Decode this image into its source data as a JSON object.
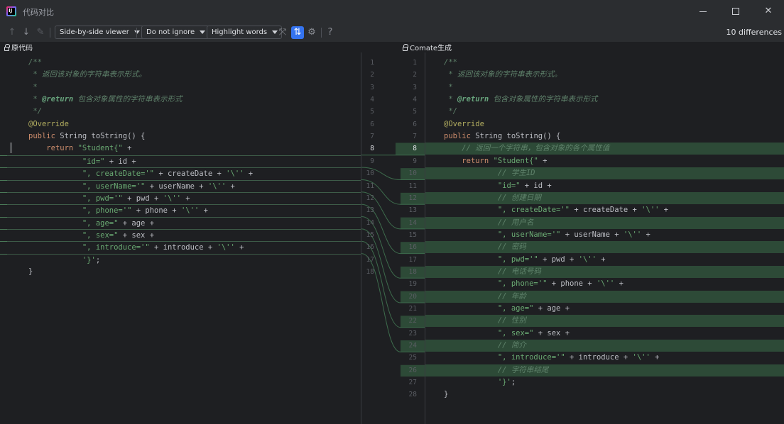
{
  "window": {
    "title": "代码对比",
    "app_icon_text": "IJ",
    "minimize_icon": "minimize-icon",
    "maximize_icon": "maximize-icon",
    "close_icon": "close-icon"
  },
  "toolbar": {
    "prev_icon": "arrow-up-icon",
    "next_icon": "arrow-down-icon",
    "edit_icon": "pencil-icon",
    "viewer_mode": "Side-by-side viewer",
    "ignore_mode": "Do not ignore",
    "highlight_mode": "Highlight words",
    "collapse_icon": "collapse-unchanged-icon",
    "sync_scroll_icon": "sync-scroll-icon",
    "settings_icon": "gear-icon",
    "help_label": "?",
    "differences": "10 differences"
  },
  "left_panel": {
    "title": "原代码",
    "lines": [
      [
        [
          "c-comment",
          "/**"
        ]
      ],
      [
        [
          "c-comment",
          " * 返回该对象的字符串表示形式。"
        ]
      ],
      [
        [
          "c-comment",
          " *"
        ]
      ],
      [
        [
          "c-comment",
          " * "
        ],
        [
          "c-doctag",
          "@return"
        ],
        [
          "c-comment",
          " 包含对象属性的字符串表示形式"
        ]
      ],
      [
        [
          "c-comment",
          " */"
        ]
      ],
      [
        [
          "c-ann",
          "@Override"
        ]
      ],
      [
        [
          "c-kw",
          "public "
        ],
        [
          "c-plain",
          "String toString() {"
        ]
      ],
      [
        [
          "c-plain",
          "    "
        ],
        [
          "c-kw",
          "return "
        ],
        [
          "c-str",
          "\"Student{\""
        ],
        [
          "c-plain",
          " +"
        ]
      ],
      [
        [
          "c-plain",
          "            "
        ],
        [
          "c-str",
          "\"id=\""
        ],
        [
          "c-plain",
          " + id +"
        ]
      ],
      [
        [
          "c-plain",
          "            "
        ],
        [
          "c-str",
          "\", createDate='\""
        ],
        [
          "c-plain",
          " + createDate + "
        ],
        [
          "c-str",
          "'\\''"
        ],
        [
          "c-plain",
          " +"
        ]
      ],
      [
        [
          "c-plain",
          "            "
        ],
        [
          "c-str",
          "\", userName='\""
        ],
        [
          "c-plain",
          " + userName + "
        ],
        [
          "c-str",
          "'\\''"
        ],
        [
          "c-plain",
          " +"
        ]
      ],
      [
        [
          "c-plain",
          "            "
        ],
        [
          "c-str",
          "\", pwd='\""
        ],
        [
          "c-plain",
          " + pwd + "
        ],
        [
          "c-str",
          "'\\''"
        ],
        [
          "c-plain",
          " +"
        ]
      ],
      [
        [
          "c-plain",
          "            "
        ],
        [
          "c-str",
          "\", phone='\""
        ],
        [
          "c-plain",
          " + phone + "
        ],
        [
          "c-str",
          "'\\''"
        ],
        [
          "c-plain",
          " +"
        ]
      ],
      [
        [
          "c-plain",
          "            "
        ],
        [
          "c-str",
          "\", age=\""
        ],
        [
          "c-plain",
          " + age +"
        ]
      ],
      [
        [
          "c-plain",
          "            "
        ],
        [
          "c-str",
          "\", sex=\""
        ],
        [
          "c-plain",
          " + sex +"
        ]
      ],
      [
        [
          "c-plain",
          "            "
        ],
        [
          "c-str",
          "\", introduce='\""
        ],
        [
          "c-plain",
          " + introduce + "
        ],
        [
          "c-str",
          "'\\''"
        ],
        [
          "c-plain",
          " +"
        ]
      ],
      [
        [
          "c-plain",
          "            "
        ],
        [
          "c-str",
          "'}'"
        ],
        [
          "c-plain",
          ";"
        ]
      ],
      [
        [
          "c-plain",
          "}"
        ]
      ]
    ],
    "line_numbers": [
      "1",
      "2",
      "3",
      "4",
      "5",
      "6",
      "7",
      "8",
      "9",
      "10",
      "11",
      "12",
      "13",
      "14",
      "15",
      "16",
      "17",
      "18"
    ]
  },
  "right_panel": {
    "title": "Comate生成",
    "lines": [
      [
        [
          "c-comment",
          "/**"
        ]
      ],
      [
        [
          "c-comment",
          " * 返回该对象的字符串表示形式。"
        ]
      ],
      [
        [
          "c-comment",
          " *"
        ]
      ],
      [
        [
          "c-comment",
          " * "
        ],
        [
          "c-doctag",
          "@return"
        ],
        [
          "c-comment",
          " 包含对象属性的字符串表示形式"
        ]
      ],
      [
        [
          "c-comment",
          " */"
        ]
      ],
      [
        [
          "c-ann",
          "@Override"
        ]
      ],
      [
        [
          "c-kw",
          "public "
        ],
        [
          "c-plain",
          "String toString() {"
        ]
      ],
      [
        [
          "c-plain",
          "    "
        ],
        [
          "c-comment",
          "// 返回一个字符串，包含对象的各个属性值"
        ]
      ],
      [
        [
          "c-plain",
          "    "
        ],
        [
          "c-kw",
          "return "
        ],
        [
          "c-str",
          "\"Student{\""
        ],
        [
          "c-plain",
          " +"
        ]
      ],
      [
        [
          "c-plain",
          "            "
        ],
        [
          "c-comment",
          "// 学生ID"
        ]
      ],
      [
        [
          "c-plain",
          "            "
        ],
        [
          "c-str",
          "\"id=\""
        ],
        [
          "c-plain",
          " + id +"
        ]
      ],
      [
        [
          "c-plain",
          "            "
        ],
        [
          "c-comment",
          "// 创建日期"
        ]
      ],
      [
        [
          "c-plain",
          "            "
        ],
        [
          "c-str",
          "\", createDate='\""
        ],
        [
          "c-plain",
          " + createDate + "
        ],
        [
          "c-str",
          "'\\''"
        ],
        [
          "c-plain",
          " +"
        ]
      ],
      [
        [
          "c-plain",
          "            "
        ],
        [
          "c-comment",
          "// 用户名"
        ]
      ],
      [
        [
          "c-plain",
          "            "
        ],
        [
          "c-str",
          "\", userName='\""
        ],
        [
          "c-plain",
          " + userName + "
        ],
        [
          "c-str",
          "'\\''"
        ],
        [
          "c-plain",
          " +"
        ]
      ],
      [
        [
          "c-plain",
          "            "
        ],
        [
          "c-comment",
          "// 密码"
        ]
      ],
      [
        [
          "c-plain",
          "            "
        ],
        [
          "c-str",
          "\", pwd='\""
        ],
        [
          "c-plain",
          " + pwd + "
        ],
        [
          "c-str",
          "'\\''"
        ],
        [
          "c-plain",
          " +"
        ]
      ],
      [
        [
          "c-plain",
          "            "
        ],
        [
          "c-comment",
          "// 电话号码"
        ]
      ],
      [
        [
          "c-plain",
          "            "
        ],
        [
          "c-str",
          "\", phone='\""
        ],
        [
          "c-plain",
          " + phone + "
        ],
        [
          "c-str",
          "'\\''"
        ],
        [
          "c-plain",
          " +"
        ]
      ],
      [
        [
          "c-plain",
          "            "
        ],
        [
          "c-comment",
          "// 年龄"
        ]
      ],
      [
        [
          "c-plain",
          "            "
        ],
        [
          "c-str",
          "\", age=\""
        ],
        [
          "c-plain",
          " + age +"
        ]
      ],
      [
        [
          "c-plain",
          "            "
        ],
        [
          "c-comment",
          "// 性别"
        ]
      ],
      [
        [
          "c-plain",
          "            "
        ],
        [
          "c-str",
          "\", sex=\""
        ],
        [
          "c-plain",
          " + sex +"
        ]
      ],
      [
        [
          "c-plain",
          "            "
        ],
        [
          "c-comment",
          "// 简介"
        ]
      ],
      [
        [
          "c-plain",
          "            "
        ],
        [
          "c-str",
          "\", introduce='\""
        ],
        [
          "c-plain",
          " + introduce + "
        ],
        [
          "c-str",
          "'\\''"
        ],
        [
          "c-plain",
          " +"
        ]
      ],
      [
        [
          "c-plain",
          "            "
        ],
        [
          "c-comment",
          "// 字符串结尾"
        ]
      ],
      [
        [
          "c-plain",
          "            "
        ],
        [
          "c-str",
          "'}'"
        ],
        [
          "c-plain",
          ";"
        ]
      ],
      [
        [
          "c-plain",
          "}"
        ]
      ]
    ],
    "line_numbers": [
      "1",
      "2",
      "3",
      "4",
      "5",
      "6",
      "7",
      "8",
      "9",
      "10",
      "11",
      "12",
      "13",
      "14",
      "15",
      "16",
      "17",
      "18",
      "19",
      "20",
      "21",
      "22",
      "23",
      "24",
      "25",
      "26",
      "27",
      "28"
    ],
    "changed_lines": [
      8,
      9,
      10,
      11,
      12,
      13,
      14,
      15,
      16,
      17,
      18,
      19,
      20,
      21,
      22,
      23,
      24,
      25,
      26
    ],
    "current_line": 8
  },
  "colors": {
    "changed_bg": "#2d4a37",
    "connector": "#3d6b4c",
    "editor_bg": "#1e1f22",
    "toolbar_bg": "#2b2d30",
    "accent": "#3574f0"
  }
}
